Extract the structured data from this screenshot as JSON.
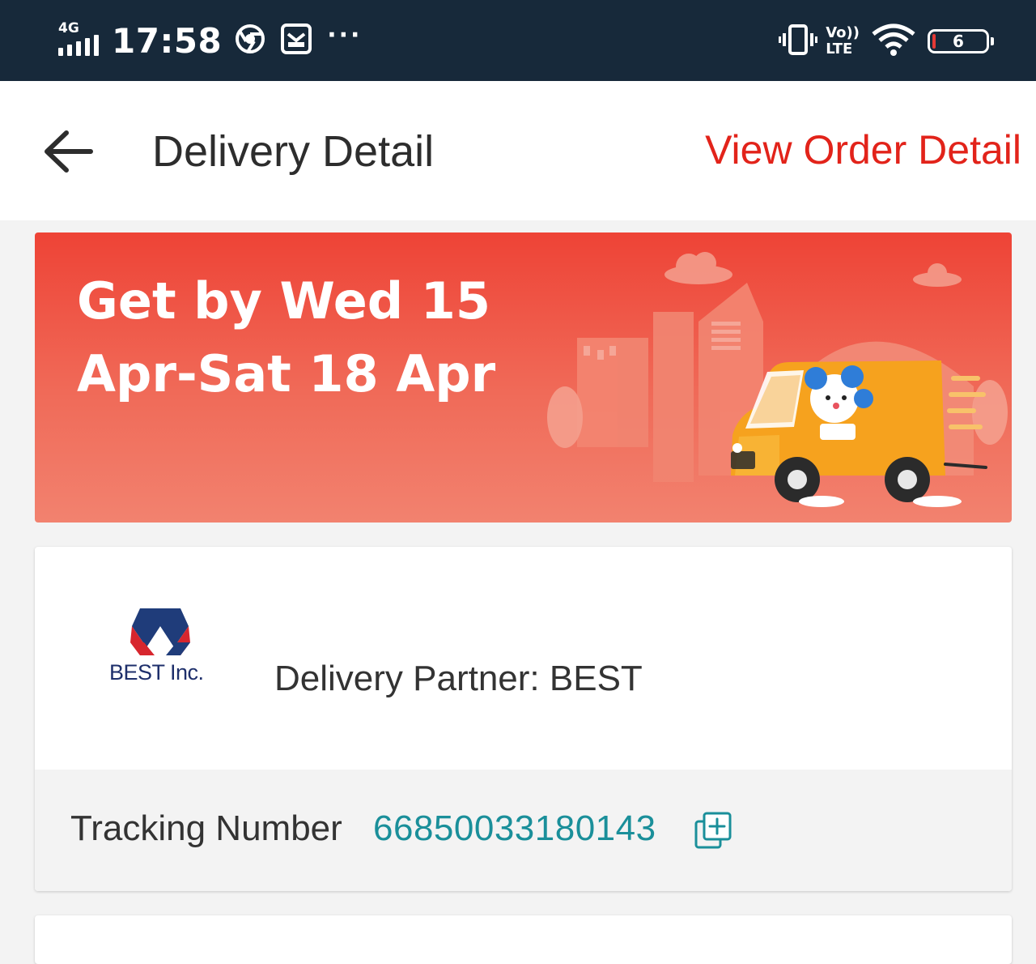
{
  "status_bar": {
    "network": "4G",
    "time": "17:58",
    "more": "···",
    "volte_top": "Vo))",
    "volte_bottom": "LTE",
    "battery_level": "6"
  },
  "header": {
    "title": "Delivery Detail",
    "view_order_link": "View Order Detail"
  },
  "banner": {
    "eta_line1": "Get by Wed 15",
    "eta_line2": "Apr-Sat 18 Apr"
  },
  "delivery": {
    "logo_text": "BEST Inc.",
    "partner_text": "Delivery Partner: BEST",
    "tracking_label": "Tracking Number",
    "tracking_number": "66850033180143"
  },
  "colors": {
    "accent": "#e2231a",
    "tracking": "#1a8f9a",
    "statusbar": "#17293a"
  }
}
